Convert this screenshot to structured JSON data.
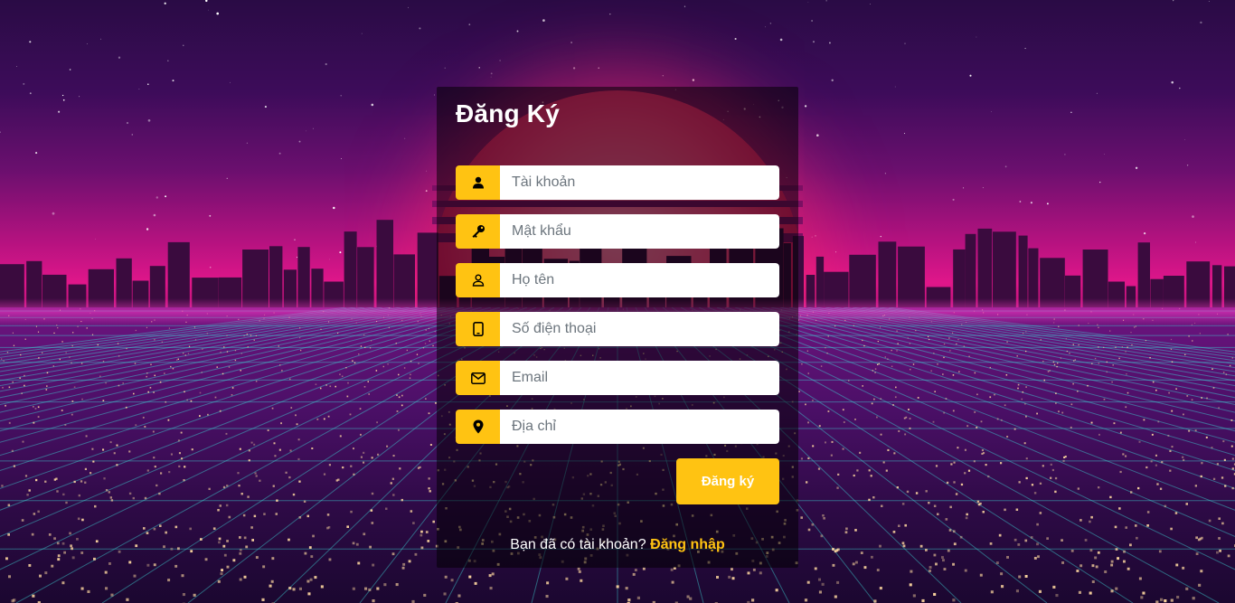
{
  "theme": {
    "accent": "#ffc312",
    "card_bg": "rgba(0,0,0,0.52)",
    "text": "#ffffff"
  },
  "form": {
    "title": "Đăng Ký",
    "fields": [
      {
        "icon": "user-icon",
        "placeholder": "Tài khoản",
        "value": ""
      },
      {
        "icon": "key-icon",
        "placeholder": "Mật khẩu",
        "value": ""
      },
      {
        "icon": "user-outline-icon",
        "placeholder": "Họ tên",
        "value": ""
      },
      {
        "icon": "mobile-phone-icon",
        "placeholder": "Số điện thoại",
        "value": ""
      },
      {
        "icon": "envelope-icon",
        "placeholder": "Email",
        "value": ""
      },
      {
        "icon": "map-marker-icon",
        "placeholder": "Địa chỉ",
        "value": ""
      }
    ],
    "submit_label": "Đăng ký"
  },
  "footer": {
    "question": "Bạn đã có tài khoản?",
    "login_link": "Đăng nhập"
  }
}
